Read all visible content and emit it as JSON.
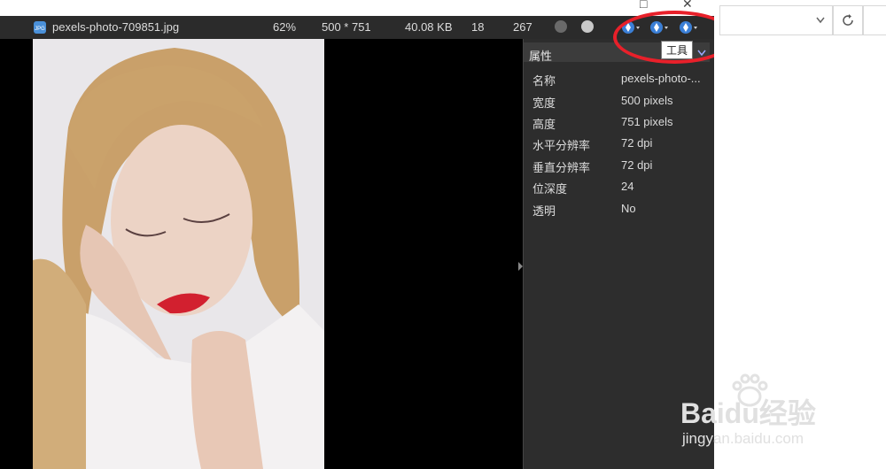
{
  "infobar": {
    "filename": "pexels-photo-709851.jpg",
    "zoom": "62%",
    "dimensions": "500 * 751",
    "filesize": "40.08 KB",
    "index": "18",
    "total": "267",
    "file_icon": "jpg-file-icon"
  },
  "tooltip": {
    "text": "工具"
  },
  "properties": {
    "title": "属性",
    "rows": [
      {
        "key": "名称",
        "value": "pexels-photo-..."
      },
      {
        "key": "宽度",
        "value": "500 pixels"
      },
      {
        "key": "高度",
        "value": "751 pixels"
      },
      {
        "key": "水平分辨率",
        "value": "72 dpi"
      },
      {
        "key": "垂直分辨率",
        "value": "72 dpi"
      },
      {
        "key": "位深度",
        "value": "24"
      },
      {
        "key": "透明",
        "value": "No"
      }
    ]
  },
  "watermark": {
    "brand": "Baidu经验",
    "url": "jingyan.baidu.com"
  },
  "colors": {
    "infobar_bg": "#2b2b2b",
    "panel_bg": "#2d2d2d",
    "highlight": "#e8202a"
  }
}
